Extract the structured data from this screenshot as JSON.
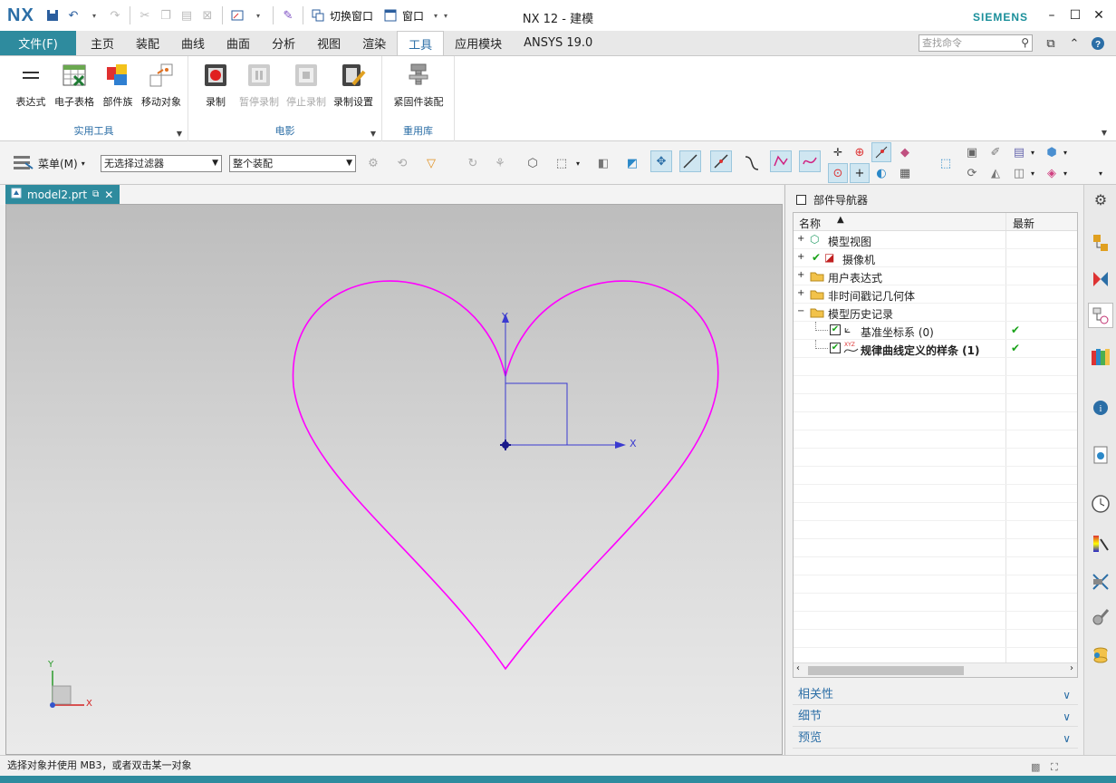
{
  "app": {
    "logo": "NX",
    "title": "NX 12 - 建模",
    "brand": "SIEMENS",
    "qat_switch_window": "切换窗口",
    "qat_window": "窗口"
  },
  "ribbon_tabs": [
    {
      "label": "文件(F)"
    },
    {
      "label": "主页"
    },
    {
      "label": "装配"
    },
    {
      "label": "曲线"
    },
    {
      "label": "曲面"
    },
    {
      "label": "分析"
    },
    {
      "label": "视图"
    },
    {
      "label": "渲染"
    },
    {
      "label": "工具"
    },
    {
      "label": "应用模块"
    },
    {
      "label": "ANSYS 19.0"
    }
  ],
  "search": {
    "placeholder": "查找命令"
  },
  "ribbon_groups": {
    "utilities": {
      "label": "实用工具",
      "buttons": [
        "表达式",
        "电子表格",
        "部件族",
        "移动对象"
      ]
    },
    "movie": {
      "label": "电影",
      "buttons": [
        "录制",
        "暂停录制",
        "停止录制",
        "录制设置"
      ]
    },
    "reuse": {
      "label": "重用库",
      "buttons": [
        "紧固件装配"
      ]
    }
  },
  "toolbar": {
    "menu_label": "菜单(M)",
    "filter_value": "无选择过滤器",
    "scope_value": "整个装配"
  },
  "document": {
    "tab": "model2.prt"
  },
  "viewport": {
    "csys_y": "Y",
    "csys_x": "X",
    "triad_y": "Y",
    "triad_x": "X",
    "curve_color": "#ff00ff"
  },
  "navigator": {
    "title": "部件导航器",
    "col_name": "名称",
    "col_latest": "最新",
    "rows": [
      {
        "label": "模型视图"
      },
      {
        "label": "摄像机"
      },
      {
        "label": "用户表达式"
      },
      {
        "label": "非时间戳记几何体"
      },
      {
        "label": "模型历史记录"
      },
      {
        "label": "基准坐标系 (0)"
      },
      {
        "label": "规律曲线定义的样条 (1)"
      }
    ],
    "sections": [
      "相关性",
      "细节",
      "预览"
    ]
  },
  "status": {
    "text": "选择对象并使用 MB3，或者双击某一对象"
  },
  "colors": {
    "accent": "#2e8b9e",
    "link": "#2b6ea6",
    "check": "#1aa31a"
  }
}
